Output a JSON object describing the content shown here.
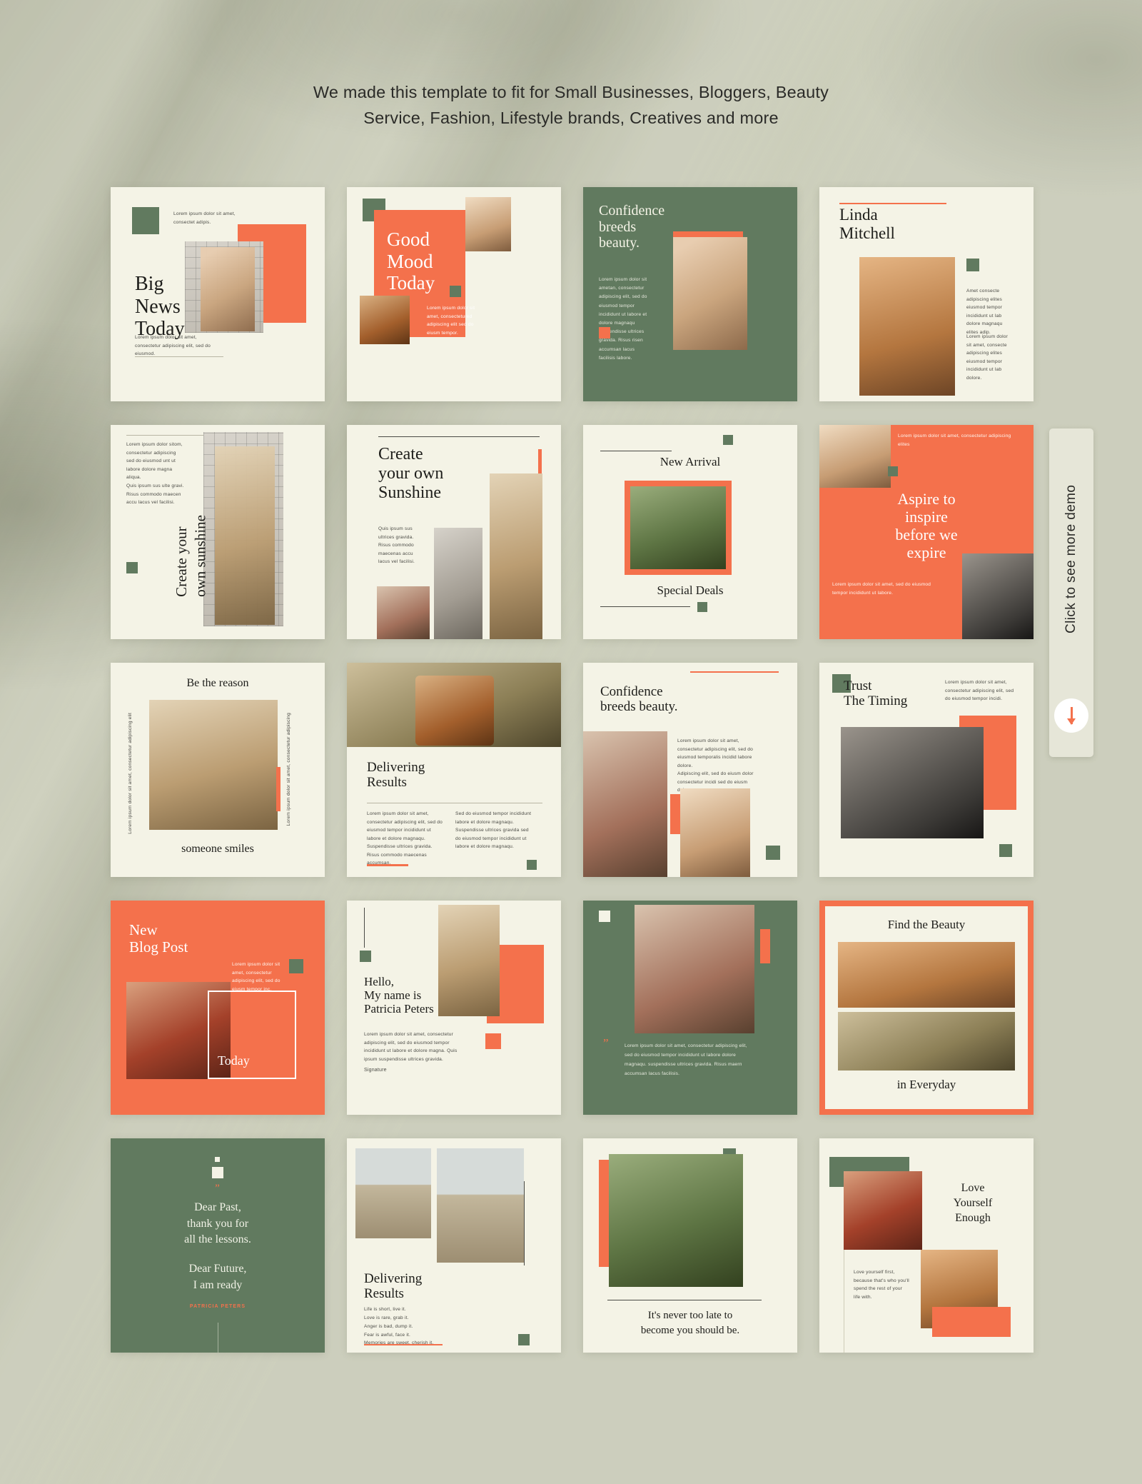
{
  "page": {
    "background_color": "#cfd1bf",
    "headline_line1": "We made this template to fit for Small Businesses, Bloggers, Beauty",
    "headline_line2": "Service, Fashion, Lifestyle brands, Creatives and more"
  },
  "palette": {
    "cream": "#f4f3e6",
    "green": "#617a5f",
    "orange": "#f4714c",
    "ink": "#1d1d1a"
  },
  "demo_tab": {
    "label": "Click to see more demo",
    "arrow_icon": "arrow-down-icon",
    "arrow_color": "#f4714c"
  },
  "cards": [
    {
      "id": "big-news-today",
      "title": "Big\nNews\nToday",
      "caption": "Lorem ipsum dolor sit amet, consectetur adipiscing elit, sed do eiusmod.",
      "top_note": "Lorem ipsum dolor sit amet, consectet adipis."
    },
    {
      "id": "good-mood-today",
      "title": "Good\nMood\nToday",
      "caption": "Lorem ipsum dolor sit amet, consectetured adipiscing elit sed do eiusm tempor."
    },
    {
      "id": "confidence-breeds-beauty-green",
      "title": "Confidence\nbreeds\nbeauty.",
      "body": "Lorem ipsum dolor sit ametan, consectetur adipiscing elit, sed do eiusmod tempor incididunt ut labore et dolore magnaqu suspendisse ultrices gravida. Risus risen accumsan lacus facilisis labore."
    },
    {
      "id": "linda-mitchell",
      "title": "Linda\nMitchell",
      "body1": "Amet consecte adipiscing elites eiusmod tempor incididunt ut lab dolore magnaqu elites adip.",
      "body2": "Lorem ipsum dolor sit amet, consecte adipiscing elites eiusmod tempor incididunt ut lab dolore."
    },
    {
      "id": "create-your-own-sunshine-vertical",
      "title": "Create your\nown sunshine",
      "body1": "Lorem ipsum dolor sitom, consectetur adipiscing sed do eiusmod unt ut labore dolore magna aliqua.",
      "body2": "Quis ipsum sus ulte gravi. Risus commodo maecen accu lacus vel facilisi."
    },
    {
      "id": "create-your-own-sunshine",
      "title": "Create\nyour own\nSunshine",
      "body": "Quis ipsum sus ultrices gravida. Risus commodo maecenas accu lacus vel facilisi."
    },
    {
      "id": "new-arrival",
      "title": "New Arrival",
      "footer": "Special Deals"
    },
    {
      "id": "aspire-to-inspire",
      "title": "Aspire to\ninspire\nbefore we\nexpire",
      "top_note": "Lorem ipsum dolor sit amet, consectetur adipiscing elites",
      "bottom_note": "Lorem ipsum dolor sit amet, sed do eiusmod tempor incididunt ut labore."
    },
    {
      "id": "be-the-reason",
      "title": "Be the reason",
      "footer": "someone smiles",
      "side_left": "Lorem ipsum dolor sit amet, consectetur adipiscing elit",
      "side_right": "Lorem ipsum dolor sit amet, consectetur adipiscing"
    },
    {
      "id": "delivering-results-bag",
      "title": "Delivering\nResults",
      "body1": "Lorem ipsum dolor sit amet, consectetur adipiscing elit, sed do eiusmod tempor incididunt ut labore et dolore magnaqu. Suspendisse ultrices gravida. Risus commodo maecenas accumsan.",
      "body2": "Sed do eiusmod tempor incididunt labore et dolore magnaqu. Suspendisse ultrices gravida sed do eiusmod tempor incididunt ut labore et dolore magnaqu."
    },
    {
      "id": "confidence-breeds-beauty-cream",
      "title": "Confidence\nbreeds beauty.",
      "body1": "Lorem ipsum dolor sit amet, consectetur adipiscing elit, sed do eiusmod temporalis incidid labore dolore.",
      "body2": "Adipiscing elit, sed do eiusm dolor consectetur incidi sed do eiusm dolore magnaqu."
    },
    {
      "id": "trust-the-timing",
      "title": "Trust\nThe Timing",
      "note": "Lorem ipsum dolor sit amet, consectetur adipiscing elit, sed do eiusmod tempor incidi."
    },
    {
      "id": "new-blog-post",
      "title": "New\nBlog Post",
      "note": "Lorem ipsum dolor sit amet, consectetur adipiscing elit, sed do eiusm tempor inc.",
      "badge": "Today"
    },
    {
      "id": "hello-patricia-peters",
      "title": "Hello,\nMy name is\nPatricia Peters",
      "body": "Lorem ipsum dolor sit amet, consectetur adipiscing elit, sed do eiusmod tempor incididunt ut labore et dolore magna. Quis ipsum suspendisse ultrices gravida.",
      "signature_label": "Signature"
    },
    {
      "id": "quote-green-photo",
      "quote_mark": "”",
      "body": "Lorem ipsum dolor sit amet, consectetur adipiscing elit, sed do eiusmod tempor incididunt ut labore dolore magnaqu. suspendisse ultrices gravida. Risus maern accumsan lacus facilisis."
    },
    {
      "id": "find-the-beauty",
      "title": "Find the Beauty",
      "footer": "in Everyday"
    },
    {
      "id": "dear-past-quote",
      "quote_mark": "”",
      "line1": "Dear Past,",
      "line2": "thank you for",
      "line3": "all the lessons.",
      "line4": "Dear Future,",
      "line5": "I am ready",
      "author": "PATRICIA PETERS"
    },
    {
      "id": "delivering-results-desert",
      "title": "Delivering\nResults",
      "body": "Life is short, live it.\nLove is rare, grab it.\nAnger is bad, dump it.\nFear is awful, face it.\nMemories are sweet, cherish it."
    },
    {
      "id": "never-too-late",
      "footer_line1": "It's never too late to",
      "footer_line2": "become you should be."
    },
    {
      "id": "love-yourself-enough",
      "title": "Love\nYourself\nEnough",
      "body": "Love yourself first, because that's who you'll spend the rest of your life with."
    }
  ]
}
